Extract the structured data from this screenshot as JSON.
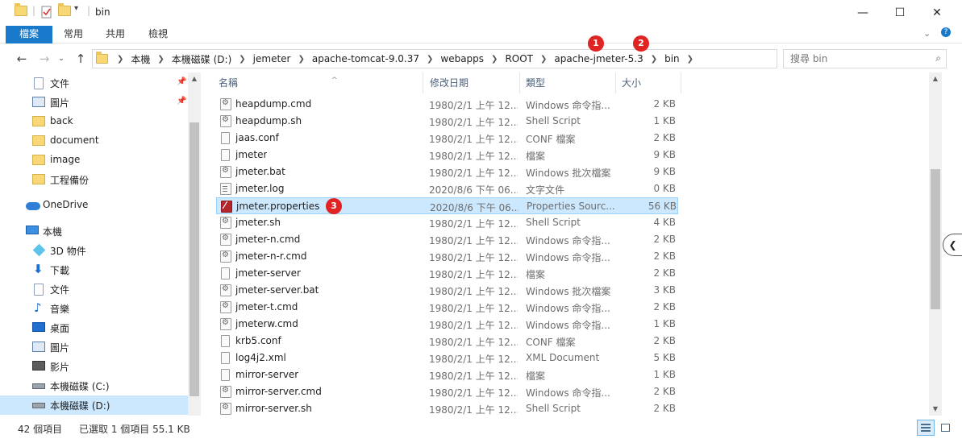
{
  "window": {
    "title": "bin",
    "minimize": "—",
    "maximize": "☐",
    "close": "✕"
  },
  "ribbon": {
    "tabs": [
      "檔案",
      "常用",
      "共用",
      "檢視"
    ],
    "expand_icon": "chevron-down-icon",
    "help_icon": "help-icon"
  },
  "address": {
    "crumbs": [
      "本機",
      "本機磁碟 (D:)",
      "jemeter",
      "apache-tomcat-9.0.37",
      "webapps",
      "ROOT",
      "apache-jmeter-5.3",
      "bin"
    ],
    "search_placeholder": "搜尋 bin"
  },
  "markers": [
    "1",
    "2",
    "3"
  ],
  "sidebar": {
    "items": [
      {
        "label": "文件",
        "icon": "document-icon",
        "pinned": true
      },
      {
        "label": "圖片",
        "icon": "pictures-icon",
        "pinned": true
      },
      {
        "label": "back",
        "icon": "folder-icon",
        "pinned": false
      },
      {
        "label": "document",
        "icon": "folder-icon",
        "pinned": false
      },
      {
        "label": "image",
        "icon": "folder-icon",
        "pinned": false
      },
      {
        "label": "工程備份",
        "icon": "folder-icon",
        "pinned": false
      },
      {
        "label": "OneDrive",
        "icon": "onedrive-icon",
        "pinned": false
      },
      {
        "label": "本機",
        "icon": "this-pc-icon",
        "pinned": false
      },
      {
        "label": "3D 物件",
        "icon": "3d-objects-icon",
        "pinned": false
      },
      {
        "label": "下載",
        "icon": "downloads-icon",
        "pinned": false
      },
      {
        "label": "文件",
        "icon": "document-icon",
        "pinned": false
      },
      {
        "label": "音樂",
        "icon": "music-icon",
        "pinned": false
      },
      {
        "label": "桌面",
        "icon": "desktop-icon",
        "pinned": false
      },
      {
        "label": "圖片",
        "icon": "pictures-icon",
        "pinned": false
      },
      {
        "label": "影片",
        "icon": "videos-icon",
        "pinned": false
      },
      {
        "label": "本機磁碟 (C:)",
        "icon": "drive-icon",
        "pinned": false
      },
      {
        "label": "本機磁碟 (D:)",
        "icon": "drive-icon",
        "pinned": false
      }
    ]
  },
  "columns": [
    "名稱",
    "修改日期",
    "類型",
    "大小"
  ],
  "files": [
    {
      "name": "heapdump.cmd",
      "date": "1980/2/1 上午 12...",
      "type": "Windows 命令指...",
      "size": "2 KB",
      "icon": "gear"
    },
    {
      "name": "heapdump.sh",
      "date": "1980/2/1 上午 12...",
      "type": "Shell Script",
      "size": "1 KB",
      "icon": "gear"
    },
    {
      "name": "jaas.conf",
      "date": "1980/2/1 上午 12...",
      "type": "CONF 檔案",
      "size": "2 KB",
      "icon": "plain"
    },
    {
      "name": "jmeter",
      "date": "1980/2/1 上午 12...",
      "type": "檔案",
      "size": "9 KB",
      "icon": "plain"
    },
    {
      "name": "jmeter.bat",
      "date": "1980/2/1 上午 12...",
      "type": "Windows 批次檔案",
      "size": "9 KB",
      "icon": "gear"
    },
    {
      "name": "jmeter.log",
      "date": "2020/8/6 下午 06...",
      "type": "文字文件",
      "size": "0 KB",
      "icon": "log"
    },
    {
      "name": "jmeter.properties",
      "date": "2020/8/6 下午 06...",
      "type": "Properties Sourc...",
      "size": "56 KB",
      "icon": "props"
    },
    {
      "name": "jmeter.sh",
      "date": "1980/2/1 上午 12...",
      "type": "Shell Script",
      "size": "4 KB",
      "icon": "gear"
    },
    {
      "name": "jmeter-n.cmd",
      "date": "1980/2/1 上午 12...",
      "type": "Windows 命令指...",
      "size": "2 KB",
      "icon": "gear"
    },
    {
      "name": "jmeter-n-r.cmd",
      "date": "1980/2/1 上午 12...",
      "type": "Windows 命令指...",
      "size": "2 KB",
      "icon": "gear"
    },
    {
      "name": "jmeter-server",
      "date": "1980/2/1 上午 12...",
      "type": "檔案",
      "size": "2 KB",
      "icon": "plain"
    },
    {
      "name": "jmeter-server.bat",
      "date": "1980/2/1 上午 12...",
      "type": "Windows 批次檔案",
      "size": "3 KB",
      "icon": "gear"
    },
    {
      "name": "jmeter-t.cmd",
      "date": "1980/2/1 上午 12...",
      "type": "Windows 命令指...",
      "size": "2 KB",
      "icon": "gear"
    },
    {
      "name": "jmeterw.cmd",
      "date": "1980/2/1 上午 12...",
      "type": "Windows 命令指...",
      "size": "1 KB",
      "icon": "gear"
    },
    {
      "name": "krb5.conf",
      "date": "1980/2/1 上午 12...",
      "type": "CONF 檔案",
      "size": "2 KB",
      "icon": "plain"
    },
    {
      "name": "log4j2.xml",
      "date": "1980/2/1 上午 12...",
      "type": "XML Document",
      "size": "5 KB",
      "icon": "plain"
    },
    {
      "name": "mirror-server",
      "date": "1980/2/1 上午 12...",
      "type": "檔案",
      "size": "1 KB",
      "icon": "plain"
    },
    {
      "name": "mirror-server.cmd",
      "date": "1980/2/1 上午 12...",
      "type": "Windows 命令指...",
      "size": "2 KB",
      "icon": "gear"
    },
    {
      "name": "mirror-server.sh",
      "date": "1980/2/1 上午 12...",
      "type": "Shell Script",
      "size": "2 KB",
      "icon": "gear"
    }
  ],
  "status": {
    "count": "42 個項目",
    "selected": "已選取 1 個項目 55.1 KB"
  }
}
